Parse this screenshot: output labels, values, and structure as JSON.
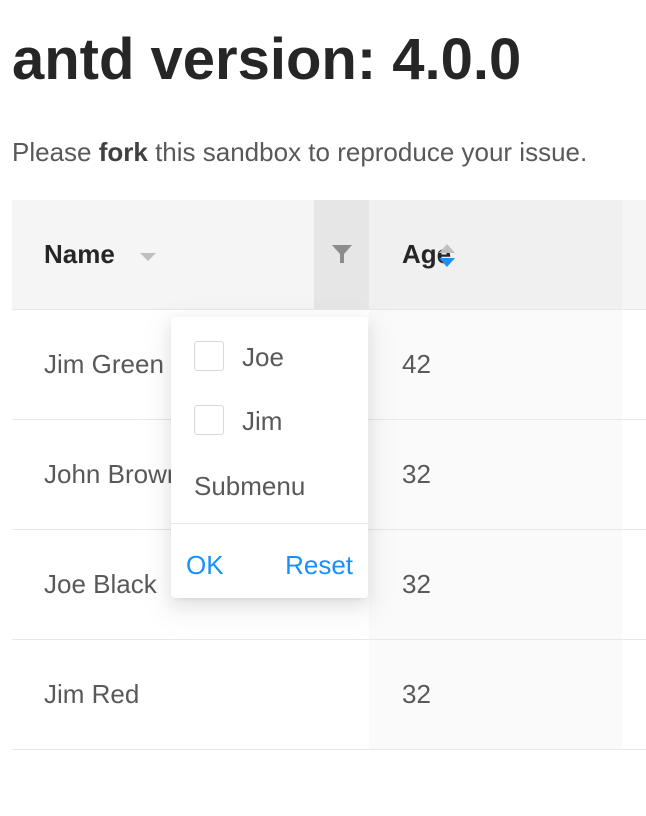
{
  "page": {
    "title": "antd version: 4.0.0",
    "intro_prefix": "Please ",
    "intro_bold": "fork",
    "intro_suffix": " this sandbox to reproduce your issue."
  },
  "table": {
    "columns": [
      {
        "label": "Name",
        "icons": [
          "caret-down-icon",
          "filter-icon"
        ]
      },
      {
        "label": "Age",
        "icons": [
          "sort-icon"
        ],
        "sort": "descend"
      }
    ],
    "rows": [
      {
        "name": "Jim Green",
        "age": "42"
      },
      {
        "name": "John Brown",
        "age": "32"
      },
      {
        "name": "Joe Black",
        "age": "32"
      },
      {
        "name": "Jim Red",
        "age": "32"
      }
    ]
  },
  "filter_dropdown": {
    "options": [
      {
        "label": "Joe",
        "checked": false
      },
      {
        "label": "Jim",
        "checked": false
      }
    ],
    "submenu_label": "Submenu",
    "ok_label": "OK",
    "reset_label": "Reset"
  },
  "colors": {
    "accent": "#1890ff",
    "header_bg": "#f5f5f5",
    "sorted_column_bg": "#fafafa"
  }
}
